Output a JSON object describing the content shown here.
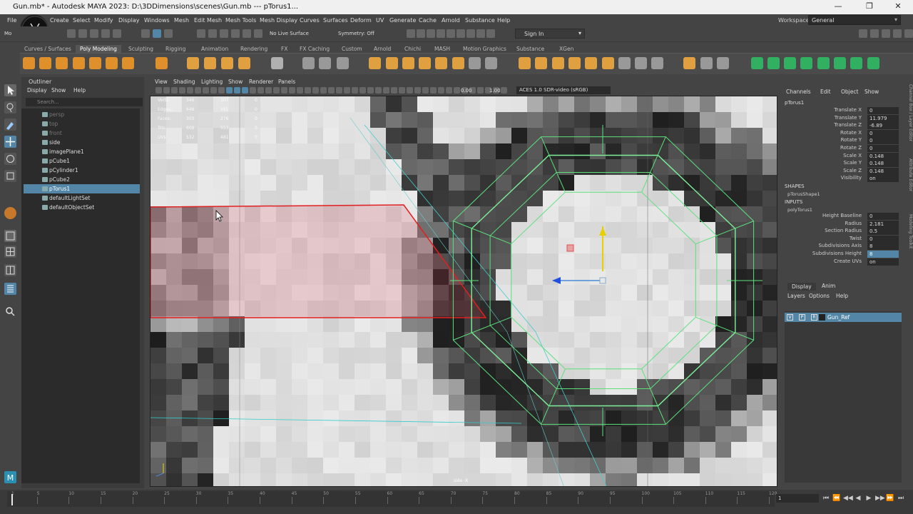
{
  "window": {
    "title": "Gun.mb* - Autodesk MAYA 2023: D:\\3DDimensions\\scenes\\Gun.mb   ---   pTorus1...",
    "minimize": "—",
    "maximize": "❐",
    "close": "✕"
  },
  "menu": [
    "File",
    "Edit",
    "Create",
    "Select",
    "Modify",
    "Display",
    "Windows",
    "Mesh",
    "Edit Mesh",
    "Mesh Tools",
    "Mesh Display",
    "Curves",
    "Surfaces",
    "Deform",
    "UV",
    "Generate",
    "Cache",
    "Arnold",
    "Substance",
    "Help"
  ],
  "workspace": {
    "label": "Workspace :",
    "value": "General"
  },
  "status_line": {
    "mode_label": "Mo",
    "live_surface": "No Live Surface",
    "symmetry": "Symmetry: Off",
    "sign_in": "Sign In"
  },
  "shelf": {
    "tabs": [
      "Curves / Surfaces",
      "Poly Modeling",
      "Sculpting",
      "Rigging",
      "Animation",
      "Rendering",
      "FX",
      "FX Caching",
      "Custom",
      "Arnold",
      "Chichi",
      "MASH",
      "Motion Graphics",
      "Substance",
      "XGen"
    ],
    "active_tab": "Poly Modeling"
  },
  "outliner": {
    "title": "Outliner",
    "menu": [
      "Display",
      "Show",
      "Help"
    ],
    "search_placeholder": "Search...",
    "items": [
      {
        "name": "persp",
        "state": "dim"
      },
      {
        "name": "top",
        "state": "dim"
      },
      {
        "name": "front",
        "state": "dim"
      },
      {
        "name": "side",
        "state": "normal"
      },
      {
        "name": "imagePlane1",
        "state": "normal"
      },
      {
        "name": "pCube1",
        "state": "normal"
      },
      {
        "name": "pCylinder1",
        "state": "normal"
      },
      {
        "name": "pCube2",
        "state": "normal"
      },
      {
        "name": "pTorus1",
        "state": "selected"
      },
      {
        "name": "defaultLightSet",
        "state": "normal"
      },
      {
        "name": "defaultObjectSet",
        "state": "normal"
      }
    ]
  },
  "viewport": {
    "menu": [
      "View",
      "Shading",
      "Lighting",
      "Show",
      "Renderer",
      "Panels"
    ],
    "exposure": "0.00",
    "gamma": "1.00",
    "color_space": "ACES 1.0 SDR-video (sRGB)",
    "hud": [
      {
        "label": "Verts:",
        "v1": "346",
        "v2": "307",
        "v3": "0"
      },
      {
        "label": "Edges:",
        "v1": "646",
        "v2": "581",
        "v3": "0"
      },
      {
        "label": "Faces:",
        "v1": "303",
        "v2": "276",
        "v3": "0"
      },
      {
        "label": "Tris:",
        "v1": "609",
        "v2": "553",
        "v3": "0"
      },
      {
        "label": "UVs:",
        "v1": "532",
        "v2": "481",
        "v3": "0"
      }
    ],
    "camera_label": "side -X"
  },
  "channel_box": {
    "menu": [
      "Channels",
      "Edit",
      "Object",
      "Show"
    ],
    "node": "pTorus1",
    "transform": [
      {
        "label": "Translate X",
        "value": "0"
      },
      {
        "label": "Translate Y",
        "value": "11.979"
      },
      {
        "label": "Translate Z",
        "value": "-6.89"
      },
      {
        "label": "Rotate X",
        "value": "0"
      },
      {
        "label": "Rotate Y",
        "value": "0"
      },
      {
        "label": "Rotate Z",
        "value": "0"
      },
      {
        "label": "Scale X",
        "value": "0.148"
      },
      {
        "label": "Scale Y",
        "value": "0.148"
      },
      {
        "label": "Scale Z",
        "value": "0.148"
      },
      {
        "label": "Visibility",
        "value": "on"
      }
    ],
    "shapes_title": "SHAPES",
    "shape_node": "pTorusShape1",
    "inputs_title": "INPUTS",
    "input_node": "polyTorus1",
    "inputs": [
      {
        "label": "Height Baseline",
        "value": "0",
        "hi": false
      },
      {
        "label": "Radius",
        "value": "2.181",
        "hi": false
      },
      {
        "label": "Section Radius",
        "value": "0.5",
        "hi": false
      },
      {
        "label": "Twist",
        "value": "0",
        "hi": false
      },
      {
        "label": "Subdivisions Axis",
        "value": "8",
        "hi": false
      },
      {
        "label": "Subdivisions Height",
        "value": "8",
        "hi": true
      },
      {
        "label": "Create UVs",
        "value": "on",
        "hi": false
      }
    ]
  },
  "layer_editor": {
    "tabs": [
      "Display",
      "Anim"
    ],
    "menu": [
      "Layers",
      "Options",
      "Help"
    ],
    "layer": {
      "v": "V",
      "p": "P",
      "r": "R",
      "name": "Gun_Ref"
    }
  },
  "side_tabs": [
    "Channel Box / Layer Editor",
    "Attribute Editor",
    "Modeling Toolkit"
  ],
  "timeline": {
    "ticks": [
      "1",
      "5",
      "10",
      "15",
      "20",
      "25",
      "30",
      "35",
      "40",
      "45",
      "50",
      "55",
      "60",
      "65",
      "70",
      "75",
      "80",
      "85",
      "90",
      "95",
      "100",
      "105",
      "110",
      "115",
      "120"
    ],
    "current_frame": "1",
    "controls": [
      "⏮",
      "⏪",
      "◀◀",
      "◀",
      "▶",
      "▶▶",
      "⏩",
      "⏭"
    ]
  }
}
